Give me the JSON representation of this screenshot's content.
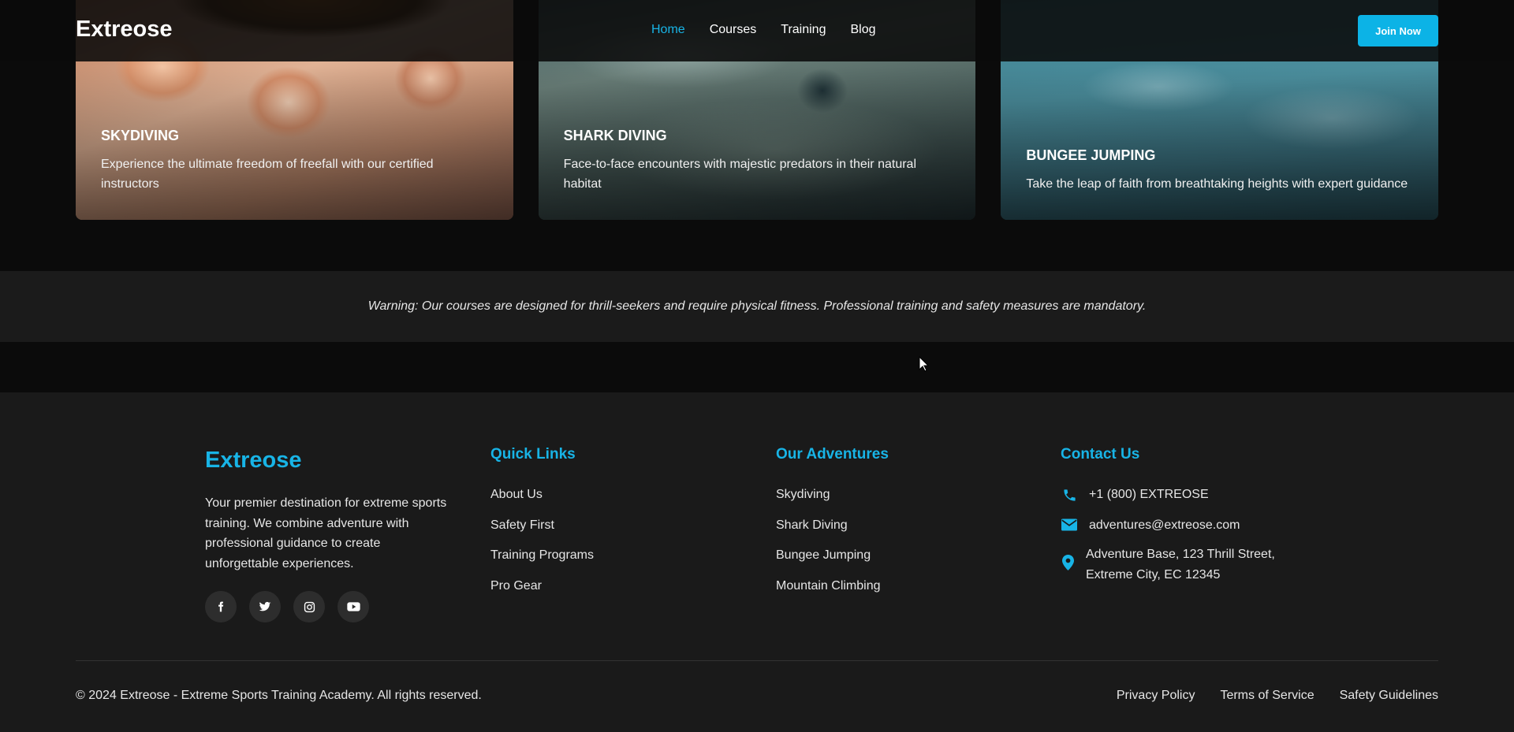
{
  "header": {
    "logo": "Extreose",
    "nav": [
      {
        "label": "Home",
        "active": true
      },
      {
        "label": "Courses",
        "active": false
      },
      {
        "label": "Training",
        "active": false
      },
      {
        "label": "Blog",
        "active": false
      }
    ],
    "join_button": "Join Now"
  },
  "cards": [
    {
      "title": "SKYDIVING",
      "description": "Experience the ultimate freedom of freefall with our certified instructors"
    },
    {
      "title": "SHARK DIVING",
      "description": "Face-to-face encounters with majestic predators in their natural habitat"
    },
    {
      "title": "BUNGEE JUMPING",
      "description": "Take the leap of faith from breathtaking heights with expert guidance"
    }
  ],
  "warning": "Warning: Our courses are designed for thrill-seekers and require physical fitness. Professional training and safety measures are mandatory.",
  "footer": {
    "brand": "Extreose",
    "about": "Your premier destination for extreme sports training. We combine adventure with professional guidance to create unforgettable experiences.",
    "socials": [
      "facebook-icon",
      "twitter-icon",
      "instagram-icon",
      "youtube-icon"
    ],
    "quick_links": {
      "heading": "Quick Links",
      "items": [
        "About Us",
        "Safety First",
        "Training Programs",
        "Pro Gear"
      ]
    },
    "adventures": {
      "heading": "Our Adventures",
      "items": [
        "Skydiving",
        "Shark Diving",
        "Bungee Jumping",
        "Mountain Climbing"
      ]
    },
    "contact": {
      "heading": "Contact Us",
      "phone": "+1 (800) EXTREOSE",
      "email": "adventures@extreose.com",
      "address_line1": "Adventure Base, 123 Thrill Street,",
      "address_line2": "Extreme City, EC 12345"
    },
    "copyright": "© 2024 Extreose - Extreme Sports Training Academy. All rights reserved.",
    "legal": [
      "Privacy Policy",
      "Terms of Service",
      "Safety Guidelines"
    ]
  },
  "colors": {
    "accent": "#18b4e6",
    "footer_bg": "#1a1a1a",
    "page_bg": "#0b0b0b"
  }
}
